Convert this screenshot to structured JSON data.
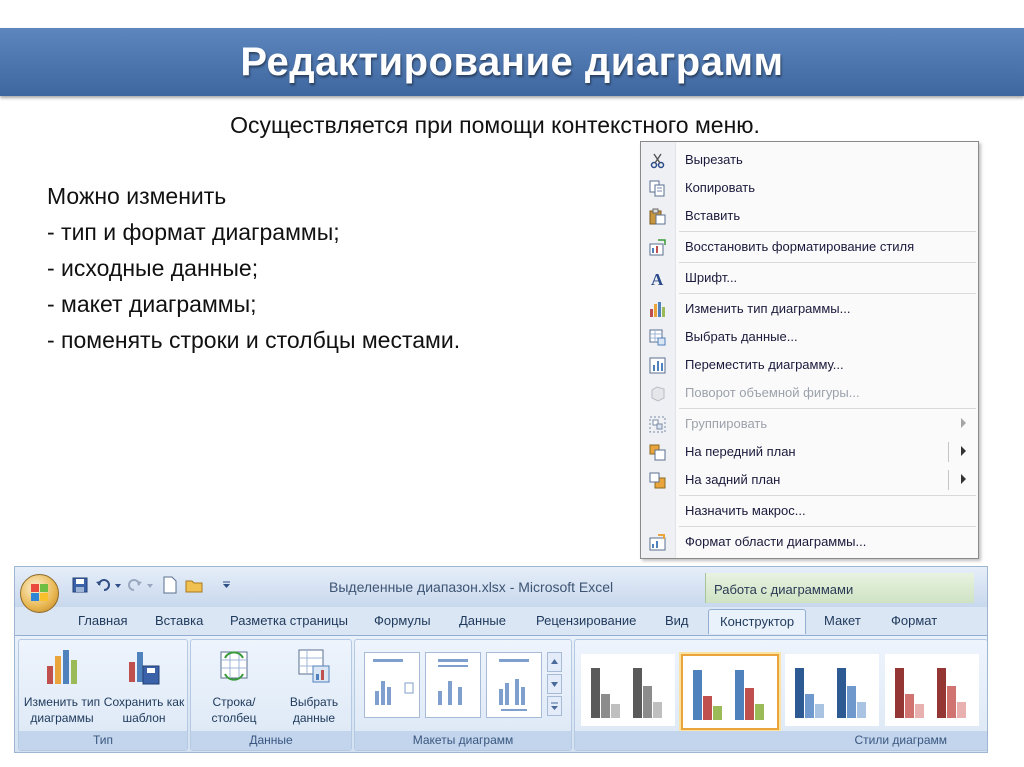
{
  "slide": {
    "title": "Редактирование диаграмм",
    "subtitle": "Осуществляется при помощи контекстного меню.",
    "body_lines": [
      "Можно изменить",
      "- тип и формат диаграммы;",
      "- исходные данные;",
      "- макет диаграммы;",
      "- поменять строки и столбцы местами."
    ]
  },
  "context_menu": {
    "items": [
      {
        "label": "Вырезать",
        "icon": "scissors-icon",
        "disabled": false,
        "submenu": false
      },
      {
        "label": "Копировать",
        "icon": "copy-icon",
        "disabled": false,
        "submenu": false
      },
      {
        "label": "Вставить",
        "icon": "paste-icon",
        "disabled": false,
        "submenu": false
      },
      {
        "label": "Восстановить форматирование стиля",
        "icon": "reset-style-icon",
        "disabled": false,
        "submenu": false
      },
      {
        "label": "Шрифт...",
        "icon": "font-icon",
        "disabled": false,
        "submenu": false
      },
      {
        "label": "Изменить тип диаграммы...",
        "icon": "chart-type-icon",
        "disabled": false,
        "submenu": false
      },
      {
        "label": "Выбрать данные...",
        "icon": "select-data-icon",
        "disabled": false,
        "submenu": false
      },
      {
        "label": "Переместить диаграмму...",
        "icon": "move-chart-icon",
        "disabled": false,
        "submenu": false
      },
      {
        "label": "Поворот объемной фигуры...",
        "icon": "rotate-3d-icon",
        "disabled": true,
        "submenu": false
      },
      {
        "label": "Группировать",
        "icon": "group-icon",
        "disabled": true,
        "submenu": true
      },
      {
        "label": "На передний план",
        "icon": "bring-front-icon",
        "disabled": false,
        "submenu": true
      },
      {
        "label": "На задний план",
        "icon": "send-back-icon",
        "disabled": false,
        "submenu": true
      },
      {
        "label": "Назначить макрос...",
        "icon": "",
        "disabled": false,
        "submenu": false
      },
      {
        "label": "Формат области диаграммы...",
        "icon": "format-area-icon",
        "disabled": false,
        "submenu": false
      }
    ]
  },
  "excel": {
    "window_title": "Выделенные диапазон.xlsx - Microsoft Excel",
    "contextual_tab_title": "Работа с диаграммами",
    "tabs": [
      "Главная",
      "Вставка",
      "Разметка страницы",
      "Формулы",
      "Данные",
      "Рецензирование",
      "Вид",
      "Конструктор",
      "Макет",
      "Формат"
    ],
    "active_tab": "Конструктор",
    "groups": {
      "type": {
        "label": "Тип",
        "btn_change_type": "Изменить тип диаграммы",
        "btn_save_template": "Сохранить как шаблон"
      },
      "data": {
        "label": "Данные",
        "btn_switch": "Строка/столбец",
        "btn_select": "Выбрать данные"
      },
      "layouts": {
        "label": "Макеты диаграмм"
      },
      "styles": {
        "label": "Стили диаграмм"
      }
    },
    "style_colors": [
      "#7f7f7f",
      "#4f81bd",
      "#4f81bd",
      "#c0504d"
    ],
    "accent_colors": {
      "title_bar": "#4a72ab",
      "ribbon": "#dbe6f4",
      "selection": "#e9a53c"
    }
  }
}
